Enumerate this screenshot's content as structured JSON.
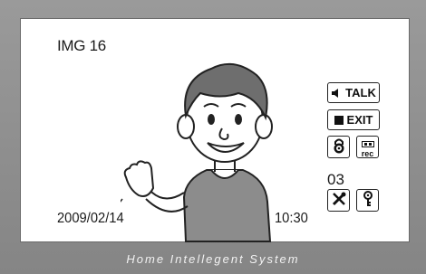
{
  "screen": {
    "image_label": "IMG 16",
    "date": "2009/02/14",
    "time": "10:30",
    "counter": "03"
  },
  "buttons": {
    "talk_label": "TALK",
    "exit_label": "EXIT",
    "rec_label": "rec"
  },
  "icons": {
    "talk": "speaker-icon",
    "exit": "stop-square-icon",
    "lock": "padlock-icon",
    "rec": "record-icon",
    "tools": "tools-icon",
    "key": "key-icon"
  },
  "footer": {
    "title": "Home Intellegent System"
  },
  "colors": {
    "frame": "#8a8a8a",
    "screen": "#ffffff",
    "figure_shirt": "#8c8c8c",
    "figure_hair": "#6e6e6e"
  }
}
